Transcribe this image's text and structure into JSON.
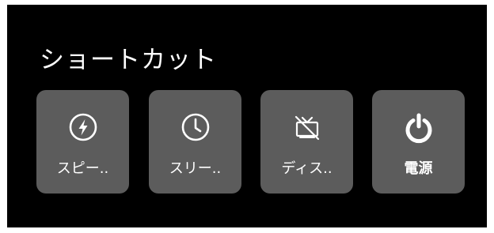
{
  "window": {
    "background": "#000000",
    "title": "ショートカット"
  },
  "shortcuts": [
    {
      "label": "スピー..",
      "icon": "lightning-bolt-circle-icon",
      "bold": false
    },
    {
      "label": "スリー..",
      "icon": "clock-icon",
      "bold": false
    },
    {
      "label": "ディス..",
      "icon": "tv-off-icon",
      "bold": false
    },
    {
      "label": "電源",
      "icon": "power-icon",
      "bold": true
    }
  ],
  "colors": {
    "tile": "#5c5c5c",
    "text": "#ffffff"
  }
}
